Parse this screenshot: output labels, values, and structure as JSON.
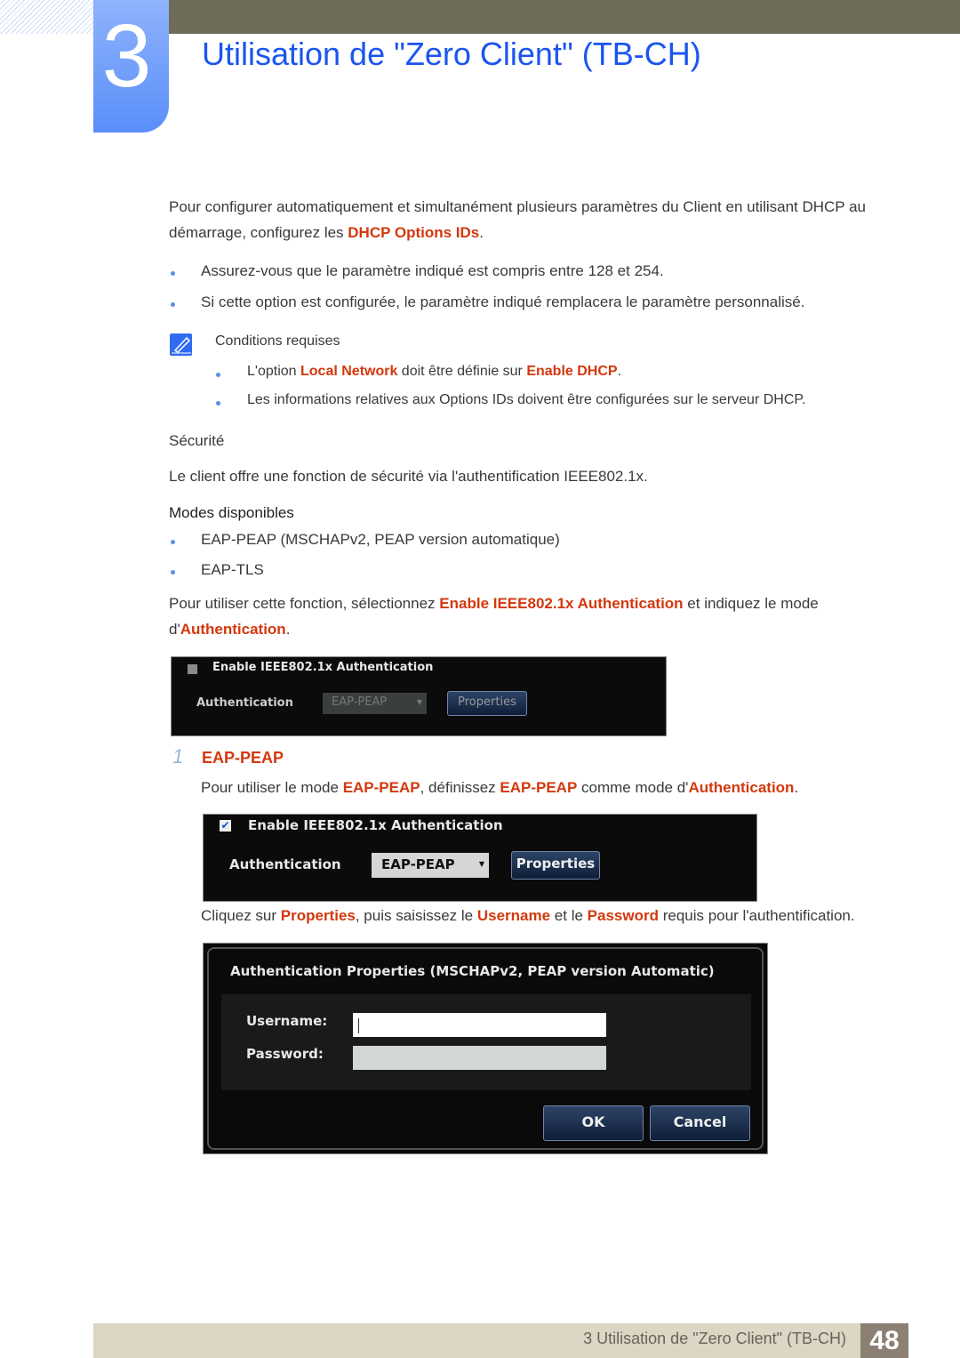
{
  "header": {
    "chapter_number": "3",
    "title": "Utilisation de \"Zero Client\" (TB-CH)"
  },
  "intro": {
    "t1": "Pour configurer automatiquement et simultanément plusieurs paramètres du Client en utilisant DHCP au",
    "t2": "démarrage, configurez les ",
    "e1": "DHCP Options IDs",
    "t3": "."
  },
  "bullets": [
    "Assurez-vous que le paramètre indiqué est compris entre 128 et 254.",
    "Si cette option est configurée, le paramètre indiqué remplacera le paramètre personnalisé."
  ],
  "note": {
    "icon": "note-pencil-icon",
    "title": "Conditions requises",
    "b1": {
      "t1": "L'option ",
      "e1": "Local Network",
      "t2": " doit être définie sur ",
      "e2": "Enable DHCP",
      "t3": "."
    },
    "b2": "Les informations relatives aux Options IDs doivent être configurées sur le serveur DHCP."
  },
  "security": {
    "heading": "Sécurité",
    "text": "Le client offre une fonction de sécurité via l'authentification IEEE802.1x.",
    "modes_heading": "Modes disponibles",
    "modes": [
      "EAP-PEAP (MSCHAPv2, PEAP version automatique)",
      "EAP-TLS"
    ],
    "use": {
      "t1": "Pour utiliser cette fonction, sélectionnez ",
      "e1": "Enable IEEE802.1x Authentication",
      "t2": " et indiquez le mode",
      "t3": "d'",
      "e2": "Authentication",
      "t4": "."
    }
  },
  "shot1": {
    "checkbox_label": "Enable IEEE802.1x Authentication",
    "checked": false,
    "auth_label": "Authentication",
    "select_value": "EAP-PEAP",
    "properties": "Properties"
  },
  "step1": {
    "number": "1",
    "title": "EAP-PEAP",
    "t1": "Pour utiliser le mode ",
    "e1": "EAP-PEAP",
    "t2": ", définissez ",
    "e2": "EAP-PEAP",
    "t3": " comme mode d'",
    "e3": "Authentication",
    "t4": "."
  },
  "shot2": {
    "checkbox_label": "Enable IEEE802.1x Authentication",
    "checked": true,
    "auth_label": "Authentication",
    "select_value": "EAP-PEAP",
    "properties": "Properties"
  },
  "click": {
    "t1": "Cliquez sur ",
    "e1": "Properties",
    "t2": ", puis saisissez le ",
    "e2": "Username",
    "t3": " et le ",
    "e3": "Password",
    "t4": " requis pour l'authentification."
  },
  "dialog": {
    "title": "Authentication Properties (MSCHAPv2, PEAP version Automatic)",
    "username_label": "Username:",
    "username_value": "",
    "password_label": "Password:",
    "password_value": "",
    "ok": "OK",
    "cancel": "Cancel"
  },
  "footer": {
    "text": "3 Utilisation de \"Zero Client\" (TB-CH)",
    "page": "48"
  },
  "colors": {
    "title": "#1a55f0",
    "emphasis": "#d4380d",
    "topbar": "#6e6b58",
    "footer": "#dcd6c4"
  }
}
